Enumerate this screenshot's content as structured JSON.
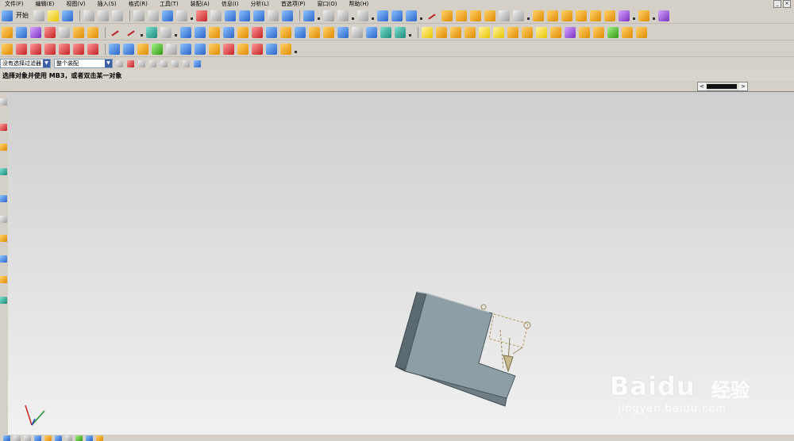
{
  "menubar": {
    "items": [
      "文件(F)",
      "编辑(E)",
      "视图(V)",
      "插入(S)",
      "格式(R)",
      "工具(T)",
      "装配(A)",
      "信息(I)",
      "分析(L)",
      "首选项(P)",
      "窗口(O)",
      "帮助(H)"
    ]
  },
  "toolbar": {
    "start_label": "开始"
  },
  "filterbar": {
    "filter_value": "没有选择过滤器",
    "assembly_value": "整个装配"
  },
  "cue": {
    "text": "选择对象并使用 MB3，或者双击某一对象"
  },
  "watermark": {
    "brand": "Baidu",
    "cn": "经验",
    "url": "jingyan.baidu.com"
  },
  "colors": {
    "part_face": "#8e9ea6",
    "part_side": "#5b6a70",
    "viewport_top": "#cfcfcf",
    "viewport_bottom": "#f1f1f1"
  }
}
